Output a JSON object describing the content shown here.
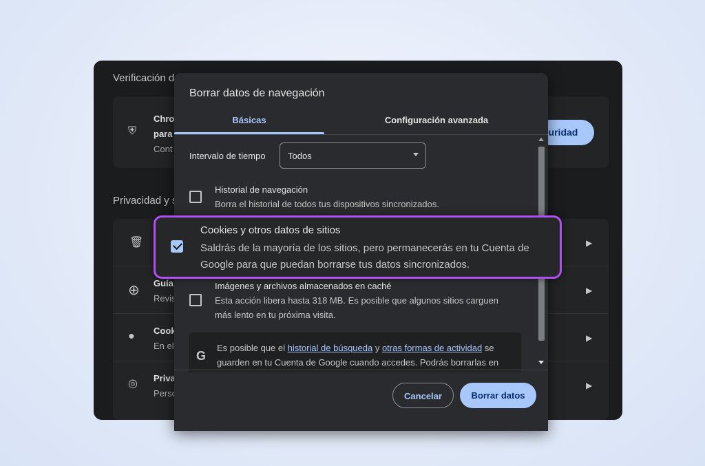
{
  "background_page": {
    "section1_title": "Verificación d",
    "card1": {
      "line1": "Chro",
      "line2": "para",
      "line3": "Cont",
      "button": "guridad"
    },
    "section2_title": "Privacidad y s",
    "rows": [
      {
        "icon": "trash-icon",
        "title": "",
        "subtitle": ""
      },
      {
        "icon": "compass-plus-icon",
        "title": "Guía",
        "subtitle": "Revis"
      },
      {
        "icon": "cookie-icon",
        "title": "Cook",
        "subtitle": "En el"
      },
      {
        "icon": "privacy-ads-icon",
        "title": "Priva",
        "subtitle": "Perso"
      }
    ]
  },
  "dialog": {
    "title": "Borrar datos de navegación",
    "tabs": [
      {
        "label": "Básicas",
        "active": true
      },
      {
        "label": "Configuración avanzada",
        "active": false
      }
    ],
    "time_range": {
      "label": "Intervalo de tiempo",
      "value": "Todos"
    },
    "items": [
      {
        "title": "Historial de navegación",
        "description": "Borra el historial de todos tus dispositivos sincronizados.",
        "checked": false
      },
      {
        "title": "Cookies y otros datos de sitios",
        "description_line1": "Saldrás de la mayoría de los sitios, pero permanecerás en tu Cuenta de",
        "description_line2": "Google para que puedan borrarse tus datos sincronizados.",
        "checked": true
      },
      {
        "title": "Imágenes y archivos almacenados en caché",
        "description_line1": "Esta acción libera hasta 318 MB. Es posible que algunos sitios carguen",
        "description_line2": "más lento en tu próxima visita.",
        "checked": false
      }
    ],
    "info": {
      "text_before": "Es posible que el ",
      "link1": "historial de búsqueda",
      "text_mid": " y ",
      "link2": "otras formas de actividad",
      "text_after": " se guarden en tu Cuenta de Google cuando accedes. Podrás borrarlas en"
    },
    "buttons": {
      "cancel": "Cancelar",
      "confirm": "Borrar datos"
    }
  },
  "colors": {
    "accent": "#a8c7fa",
    "highlight_border": "#b04ff5",
    "dialog_bg": "#2a2b2e"
  }
}
